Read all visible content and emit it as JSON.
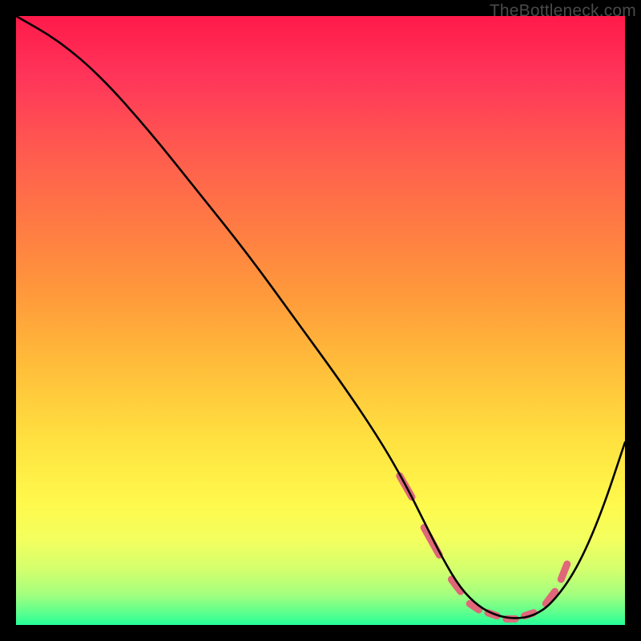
{
  "watermark": "TheBottleneck.com",
  "chart_data": {
    "type": "line",
    "title": "",
    "xlabel": "",
    "ylabel": "",
    "xlim": [
      0,
      100
    ],
    "ylim": [
      0,
      100
    ],
    "series": [
      {
        "name": "curve",
        "x": [
          0,
          7,
          14,
          22,
          30,
          38,
          46,
          54,
          60,
          64,
          67,
          70,
          73,
          76,
          79,
          82,
          85,
          88,
          92,
          96,
          100
        ],
        "values": [
          100,
          96,
          90,
          81,
          71,
          61,
          50,
          39,
          30,
          23,
          17,
          11,
          6,
          3,
          1.5,
          1,
          1.5,
          3.5,
          9,
          18,
          30
        ]
      }
    ],
    "highlight_dashes": [
      {
        "x0": 63,
        "y0": 24.5,
        "x1": 65,
        "y1": 21
      },
      {
        "x0": 67,
        "y0": 16,
        "x1": 69.5,
        "y1": 11.5
      },
      {
        "x0": 71.5,
        "y0": 7.5,
        "x1": 73,
        "y1": 5.5
      },
      {
        "x0": 74.5,
        "y0": 3.5,
        "x1": 76,
        "y1": 2.5
      },
      {
        "x0": 77.5,
        "y0": 2,
        "x1": 79,
        "y1": 1.5
      },
      {
        "x0": 80.5,
        "y0": 1,
        "x1": 82,
        "y1": 1
      },
      {
        "x0": 83.5,
        "y0": 1.5,
        "x1": 85,
        "y1": 2
      },
      {
        "x0": 87,
        "y0": 3.5,
        "x1": 88.5,
        "y1": 5.5
      },
      {
        "x0": 89.5,
        "y0": 7.5,
        "x1": 90.5,
        "y1": 10
      }
    ],
    "colors": {
      "gradient_top": "#ff1a4a",
      "gradient_bottom": "#24ff98",
      "curve": "#000000",
      "highlight": "#e0667a"
    }
  }
}
